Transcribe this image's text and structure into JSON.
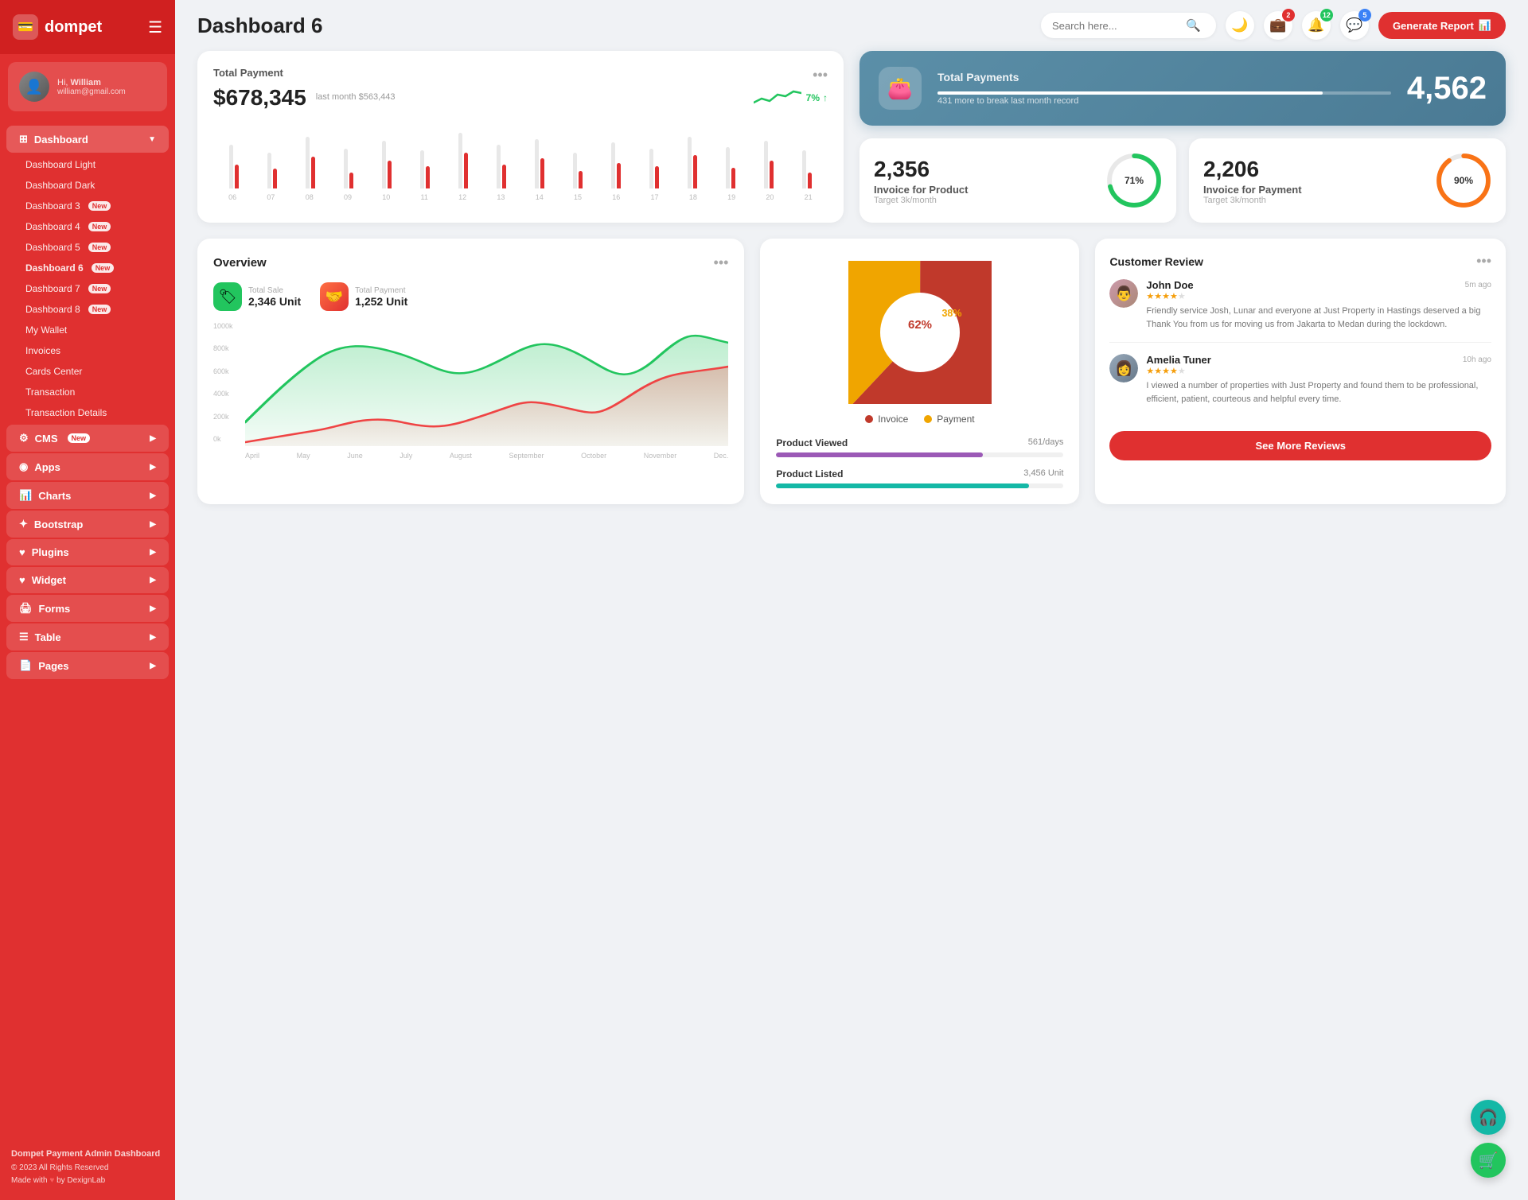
{
  "sidebar": {
    "logo": "dompet",
    "user": {
      "hi": "Hi,",
      "name": "William",
      "email": "william@gmail.com"
    },
    "nav": {
      "dashboard_label": "Dashboard",
      "items": [
        {
          "label": "Dashboard Light",
          "badge": "",
          "active": false
        },
        {
          "label": "Dashboard Dark",
          "badge": "",
          "active": false
        },
        {
          "label": "Dashboard 3",
          "badge": "New",
          "active": false
        },
        {
          "label": "Dashboard 4",
          "badge": "New",
          "active": false
        },
        {
          "label": "Dashboard 5",
          "badge": "New",
          "active": false
        },
        {
          "label": "Dashboard 6",
          "badge": "New",
          "active": true
        },
        {
          "label": "Dashboard 7",
          "badge": "New",
          "active": false
        },
        {
          "label": "Dashboard 8",
          "badge": "New",
          "active": false
        },
        {
          "label": "My Wallet",
          "badge": "",
          "active": false
        },
        {
          "label": "Invoices",
          "badge": "",
          "active": false
        },
        {
          "label": "Cards Center",
          "badge": "",
          "active": false
        },
        {
          "label": "Transaction",
          "badge": "",
          "active": false
        },
        {
          "label": "Transaction Details",
          "badge": "",
          "active": false
        }
      ],
      "sections": [
        {
          "label": "CMS",
          "badge": "New",
          "has_arrow": true
        },
        {
          "label": "Apps",
          "badge": "",
          "has_arrow": true
        },
        {
          "label": "Charts",
          "badge": "",
          "has_arrow": true
        },
        {
          "label": "Bootstrap",
          "badge": "",
          "has_arrow": true
        },
        {
          "label": "Plugins",
          "badge": "",
          "has_arrow": true
        },
        {
          "label": "Widget",
          "badge": "",
          "has_arrow": true
        },
        {
          "label": "Forms",
          "badge": "",
          "has_arrow": true
        },
        {
          "label": "Table",
          "badge": "",
          "has_arrow": true
        },
        {
          "label": "Pages",
          "badge": "",
          "has_arrow": true
        }
      ]
    },
    "footer": {
      "title": "Dompet Payment Admin Dashboard",
      "copy": "© 2023 All Rights Reserved",
      "made": "Made with",
      "by": "by DexignLab"
    }
  },
  "topbar": {
    "title": "Dashboard 6",
    "search_placeholder": "Search here...",
    "badges": {
      "wallet": "2",
      "bell": "12",
      "chat": "5"
    },
    "generate_btn": "Generate Report"
  },
  "total_payment": {
    "title": "Total Payment",
    "value": "$678,345",
    "sub": "last month $563,443",
    "trend": "7%",
    "trend_up": true,
    "dots": "..."
  },
  "total_payments_blue": {
    "title": "Total Payments",
    "subtitle": "431 more to break last month record",
    "value": "4,562"
  },
  "invoice_product": {
    "value": "2,356",
    "label": "Invoice for Product",
    "target": "Target 3k/month",
    "percent": 71,
    "color": "#22c55e"
  },
  "invoice_payment": {
    "value": "2,206",
    "label": "Invoice for Payment",
    "target": "Target 3k/month",
    "percent": 90,
    "color": "#f97316"
  },
  "overview": {
    "title": "Overview",
    "total_sale": {
      "label": "Total Sale",
      "value": "2,346 Unit"
    },
    "total_payment": {
      "label": "Total Payment",
      "value": "1,252 Unit"
    },
    "x_labels": [
      "April",
      "May",
      "June",
      "July",
      "August",
      "September",
      "October",
      "November",
      "Dec."
    ],
    "y_labels": [
      "1000k",
      "800k",
      "600k",
      "400k",
      "200k",
      "0k"
    ]
  },
  "pie_chart": {
    "invoice_pct": 62,
    "payment_pct": 38,
    "invoice_label": "Invoice",
    "payment_label": "Payment",
    "invoice_color": "#c0392b",
    "payment_color": "#f0a500"
  },
  "product_stats": [
    {
      "name": "Product Viewed",
      "value": "561/days",
      "percent": 72,
      "color": "#9b59b6"
    },
    {
      "name": "Product Listed",
      "value": "3,456 Unit",
      "percent": 88,
      "color": "#14b8a6"
    }
  ],
  "customer_review": {
    "title": "Customer Review",
    "reviews": [
      {
        "name": "John Doe",
        "time": "5m ago",
        "stars": 4,
        "text": "Friendly service Josh, Lunar and everyone at Just Property in Hastings deserved a big Thank You from us for moving us from Jakarta to Medan during the lockdown."
      },
      {
        "name": "Amelia Tuner",
        "time": "10h ago",
        "stars": 4,
        "text": "I viewed a number of properties with Just Property and found them to be professional, efficient, patient, courteous and helpful every time."
      }
    ],
    "see_more": "See More Reviews"
  }
}
